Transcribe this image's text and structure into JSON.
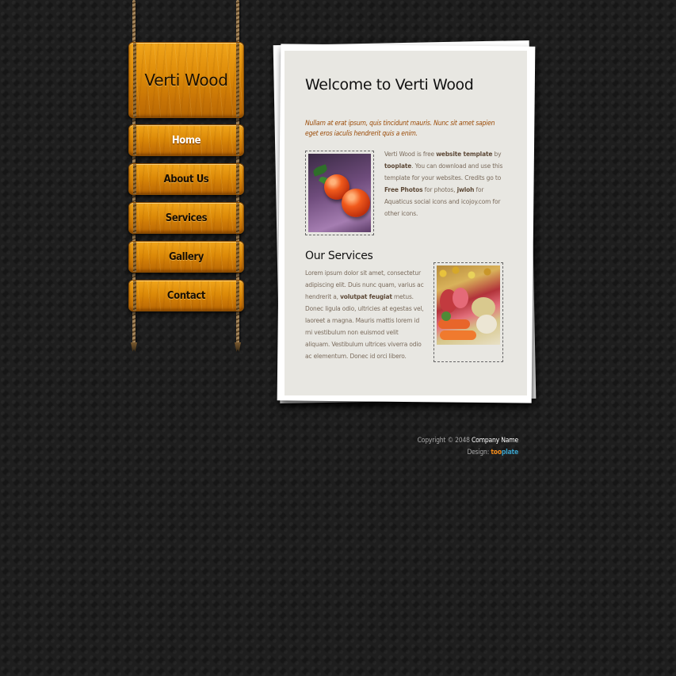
{
  "site": {
    "logo_text": "Verti Wood"
  },
  "nav": {
    "items": [
      {
        "label": "Home",
        "active": true
      },
      {
        "label": "About Us",
        "active": false
      },
      {
        "label": "Services",
        "active": false
      },
      {
        "label": "Gallery",
        "active": false
      },
      {
        "label": "Contact",
        "active": false
      }
    ]
  },
  "main": {
    "title": "Welcome to Verti Wood",
    "intro": "Nullam at erat ipsum, quis tincidunt mauris. Nunc sit amet sapien eget eros iaculis hendrerit quis a enim.",
    "welcome_paragraph": {
      "t1": "Verti Wood is free ",
      "link1": "website template",
      "t2": " by ",
      "link2": "tooplate",
      "t3": ". You can download and use this template for your websites. Credits go to ",
      "link3": "Free Photos",
      "t4": " for photos, ",
      "link4": "jwloh",
      "t5": " for Aquaticus social icons and ",
      "link5": "icojoy.com",
      "t6": " for other icons."
    },
    "services_title": "Our Services",
    "services_paragraph": {
      "t1": "Lorem ipsum dolor sit amet, consectetur adipiscing elit. Duis nunc quam, varius ac hendrerit a, ",
      "link1": "volutpat feugiat",
      "t2": " metus. Donec ligula odio, ultricies at egestas vel, laoreet a magna. Mauris mattis lorem id mi vestibulum non euismod velit aliquam. Vestibulum ultrices viverra odio ac elementum. Donec id orci libero."
    }
  },
  "footer": {
    "copyright_prefix": "Copyright © 2048 ",
    "company": "Company Name",
    "design_prefix": "Design: ",
    "brand_part1": "too",
    "brand_part2": "plate"
  },
  "colors": {
    "background": "#1e1e1e",
    "wood": "#dc8a08",
    "paper_inner": "#e8e7e2",
    "intro_text": "#9a4a06",
    "brand_orange": "#f08a1c",
    "brand_blue": "#3aa0c8"
  }
}
